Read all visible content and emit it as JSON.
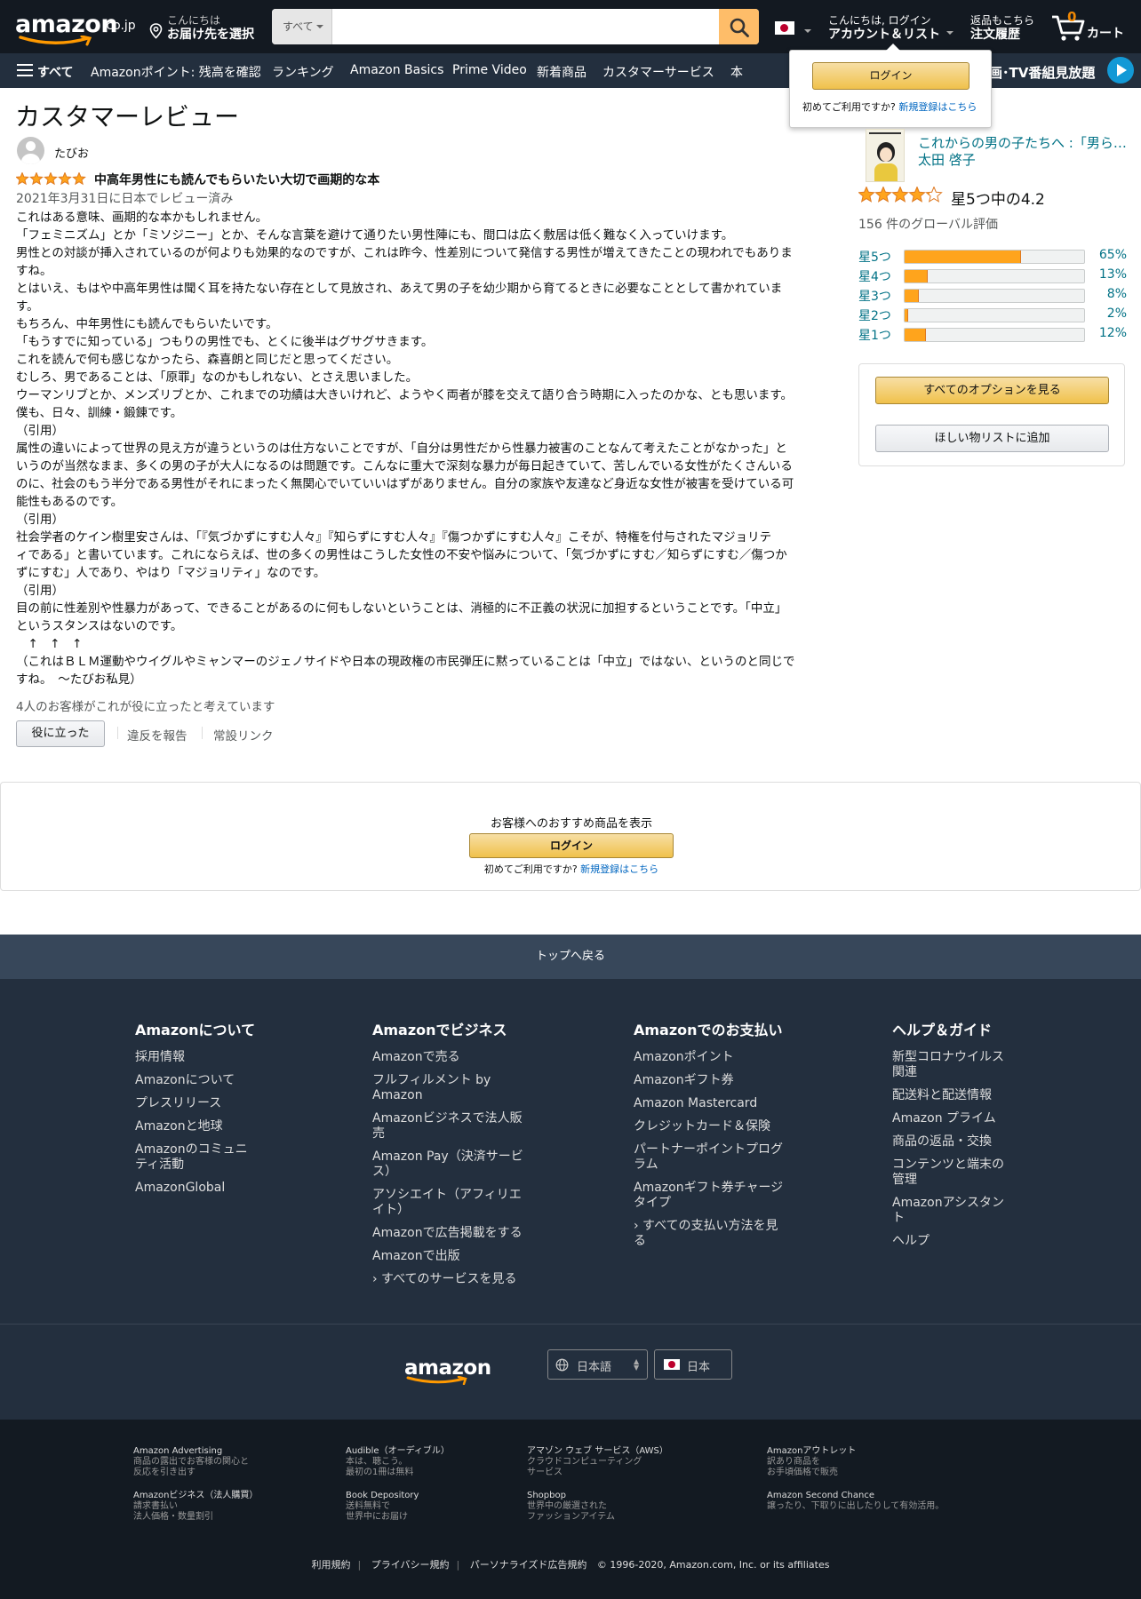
{
  "header": {
    "logo_text": "amazon",
    "logo_tld": ".co.jp",
    "deliver_line1": "こんにちは",
    "deliver_line2": "お届け先を選択",
    "search_category": "すべて",
    "search_placeholder": "",
    "account_line1": "こんにちは, ログイン",
    "account_line2": "アカウント＆リスト",
    "orders_line1": "返品もこちら",
    "orders_line2": "注文履歴",
    "cart_count": "0",
    "cart_label": "カート"
  },
  "subnav": {
    "all": "すべて",
    "items": [
      "Amazonポイント: 残高を確認",
      "ランキング",
      "Amazon Basics",
      "Prime Video",
      "新着商品",
      "カスタマーサービス",
      "本"
    ],
    "promo": "映画･TV番組見放題"
  },
  "popover": {
    "login": "ログイン",
    "new_prefix": "初めてご利用ですか?",
    "new_link": "新規登録はこちら"
  },
  "review": {
    "page_title": "カスタマーレビュー",
    "reviewer": "たびお",
    "rating": 5,
    "headline": "中高年男性にも読んでもらいたい大切で画期的な本",
    "date": "2021年3月31日に日本でレビュー済み",
    "body": [
      "これはある意味、画期的な本かもしれません。",
      "「フェミニズム」とか「ミソジニー」とか、そんな言葉を避けて通りたい男性陣にも、間口は広く敷居は低く難なく入っていけます。",
      "男性との対談が挿入されているのが何よりも効果的なのですが、これは昨今、性差別について発信する男性が増えてきたことの現われでもありま",
      "すね。",
      "とはいえ、もはや中高年男性は聞く耳を持たない存在として見放され、あえて男の子を幼少期から育てるときに必要なこととして書かれていま",
      "す。",
      "もちろん、中年男性にも読んでもらいたいです。",
      "「もうすでに知っている」つもりの男性でも、とくに後半はグサグサきます。",
      "これを読んで何も感じなかったら、森喜朗と同じだと思ってください。",
      "むしろ、男であることは、「原罪」なのかもしれない、とさえ思いました。",
      "ウーマンリブとか、メンズリブとか、これまでの功績は大きいけれど、ようやく両者が膝を交えて語り合う時期に入ったのかな、とも思います。",
      "僕も、日々、訓練・鍛錬です。",
      "（引用）",
      "属性の違いによって世界の見え方が違うというのは仕方ないことですが、「自分は男性だから性暴力被害のことなんて考えたことがなかった」と",
      "いうのが当然なまま、多くの男の子が大人になるのは問題です。こんなに重大で深刻な暴力が毎日起きていて、苦しんでいる女性がたくさんいる",
      "のに、社会のもう半分である男性がそれにまったく無関心でいていいはずがありません。自分の家族や友達など身近な女性が被害を受けている可",
      "能性もあるのです。",
      "（引用）",
      "社会学者のケイン樹里安さんは、「『気づかずにすむ人々』『知らずにすむ人々』『傷つかずにすむ人々』こそが、特権を付与されたマジョリテ",
      "ィである」と書いています。これにならえば、世の多くの男性はこうした女性の不安や悩みについて、「気づかずにすむ／知らずにすむ／傷つか",
      "ずにすむ」人であり、やはり「マジョリティ」なのです。",
      "（引用）",
      "目の前に性差別や性暴力があって、できることがあるのに何もしないということは、消極的に不正義の状況に加担するということです。「中立」",
      "というスタンスはないのです。",
      "　↑　↑　↑",
      "（これはＢＬＭ運動やウイグルやミャンマーのジェノサイドや日本の現政権の市民弾圧に黙っていることは「中立」ではない、というのと同じで",
      "すね。　～たびお私見）"
    ],
    "helpful_count": "4人のお客様がこれが役に立ったと考えています",
    "helpful_button": "役に立った",
    "report": "違反を報告",
    "permalink": "常設リンク"
  },
  "product": {
    "title": "これからの男の子たちへ :「男らしさ」から自由になるためのレッスン",
    "author": "太田 啓子",
    "avg_rating": 4.2,
    "avg_text": "星5つ中の4.2",
    "global_count": "156 件のグローバル評価",
    "histogram": [
      {
        "label": "星5つ",
        "percent": 65,
        "percent_text": "65%"
      },
      {
        "label": "星4つ",
        "percent": 13,
        "percent_text": "13%"
      },
      {
        "label": "星3つ",
        "percent": 8,
        "percent_text": "8%"
      },
      {
        "label": "星2つ",
        "percent": 2,
        "percent_text": "2%"
      },
      {
        "label": "星1つ",
        "percent": 12,
        "percent_text": "12%"
      }
    ],
    "see_all_options": "すべてのオプションを見る",
    "add_to_wishlist": "ほしい物リストに追加"
  },
  "reco": {
    "title": "お客様へのおすすめ商品を表示",
    "login": "ログイン",
    "new_prefix": "初めてご利用ですか?",
    "new_link": "新規登録はこちら"
  },
  "back_to_top": "トップへ戻る",
  "footer": {
    "columns": [
      {
        "title": "Amazonについて",
        "links": [
          "採用情報",
          "Amazonについて",
          "プレスリリース",
          "Amazonと地球",
          "Amazonのコミュニティ活動",
          "AmazonGlobal"
        ]
      },
      {
        "title": "Amazonでビジネス",
        "links": [
          "Amazonで売る",
          "フルフィルメント by Amazon",
          "Amazonビジネスで法人販売",
          "Amazon Pay（決済サービス）",
          "アソシエイト（アフィリエイト）",
          "Amazonで広告掲載をする",
          "Amazonで出版",
          "› すべてのサービスを見る"
        ]
      },
      {
        "title": "Amazonでのお支払い",
        "links": [
          "Amazonポイント",
          "Amazonギフト券",
          "Amazon Mastercard",
          "クレジットカード＆保険",
          "パートナーポイントプログラム",
          "Amazonギフト券チャージタイプ",
          "› すべての支払い方法を見る"
        ]
      },
      {
        "title": "ヘルプ＆ガイド",
        "links": [
          "新型コロナウイルス関連",
          "配送料と配送情報",
          "Amazon プライム",
          "商品の返品・交換",
          "コンテンツと端末の管理",
          "Amazonアシスタント",
          "ヘルプ"
        ]
      }
    ],
    "logo": "amazon",
    "language": "日本語",
    "country": "日本",
    "services": [
      {
        "name": "Amazon Advertising",
        "desc1": "商品の露出でお客様の関心と",
        "desc2": "反応を引き出す"
      },
      {
        "name": "Audible（オーディブル）",
        "desc1": "本は、聴こう。",
        "desc2": "最初の1冊は無料"
      },
      {
        "name": "アマゾン ウェブ サービス（AWS）",
        "desc1": "クラウドコンピューティング",
        "desc2": "サービス"
      },
      {
        "name": "Amazonアウトレット",
        "desc1": "訳あり商品を",
        "desc2": "お手頃価格で販売"
      },
      {
        "name": "Amazonビジネス（法人購買）",
        "desc1": "請求書払い",
        "desc2": "法人価格・数量割引"
      },
      {
        "name": "Book Depository",
        "desc1": "送料無料で",
        "desc2": "世界中にお届け"
      },
      {
        "name": "Shopbop",
        "desc1": "世界中の厳選された",
        "desc2": "ファッションアイテム"
      },
      {
        "name": "Amazon Second Chance",
        "desc1": "譲ったり、下取りに出したりして有効活用。",
        "desc2": ""
      }
    ],
    "legal": [
      "利用規約",
      "プライバシー規約",
      "パーソナライズド広告規約"
    ],
    "copyright": "© 1996-2020, Amazon.com, Inc. or its affiliates"
  },
  "colors": {
    "nav_dark": "#131921",
    "nav_sub": "#232f3e",
    "search_button": "#febd69",
    "star": "#ffa41c",
    "link": "#007185",
    "back_to_top": "#37475a",
    "footer_bottom": "#131a22"
  }
}
